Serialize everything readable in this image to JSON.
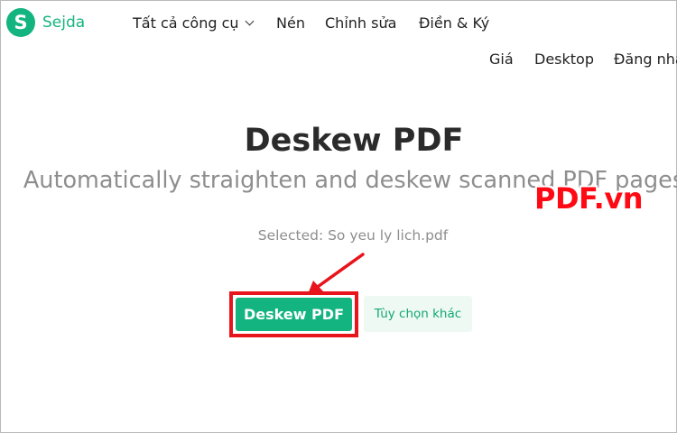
{
  "brand": {
    "logo_letter": "S",
    "name": "Sejda",
    "color": "#13b47f"
  },
  "nav": {
    "primary": [
      {
        "label": "Tất cả công cụ",
        "has_dropdown": true
      },
      {
        "label": "Nén"
      },
      {
        "label": "Chỉnh sửa"
      },
      {
        "label": "Điền & Ký"
      }
    ],
    "secondary": [
      {
        "label": "Giá"
      },
      {
        "label": "Desktop"
      },
      {
        "label": "Đăng nhậ"
      }
    ]
  },
  "main": {
    "title": "Deskew PDF",
    "subtitle": "Automatically straighten and deskew scanned PDF pages",
    "selected_file": "Selected: So yeu ly lich.pdf",
    "primary_button": "Deskew PDF",
    "secondary_button": "Tùy chọn khác"
  },
  "watermark": {
    "text": "PDF.vn",
    "color": "#ff0a14"
  },
  "annotation": {
    "color": "#e8141b",
    "arrow_icon": "arrow-down-left-icon"
  }
}
